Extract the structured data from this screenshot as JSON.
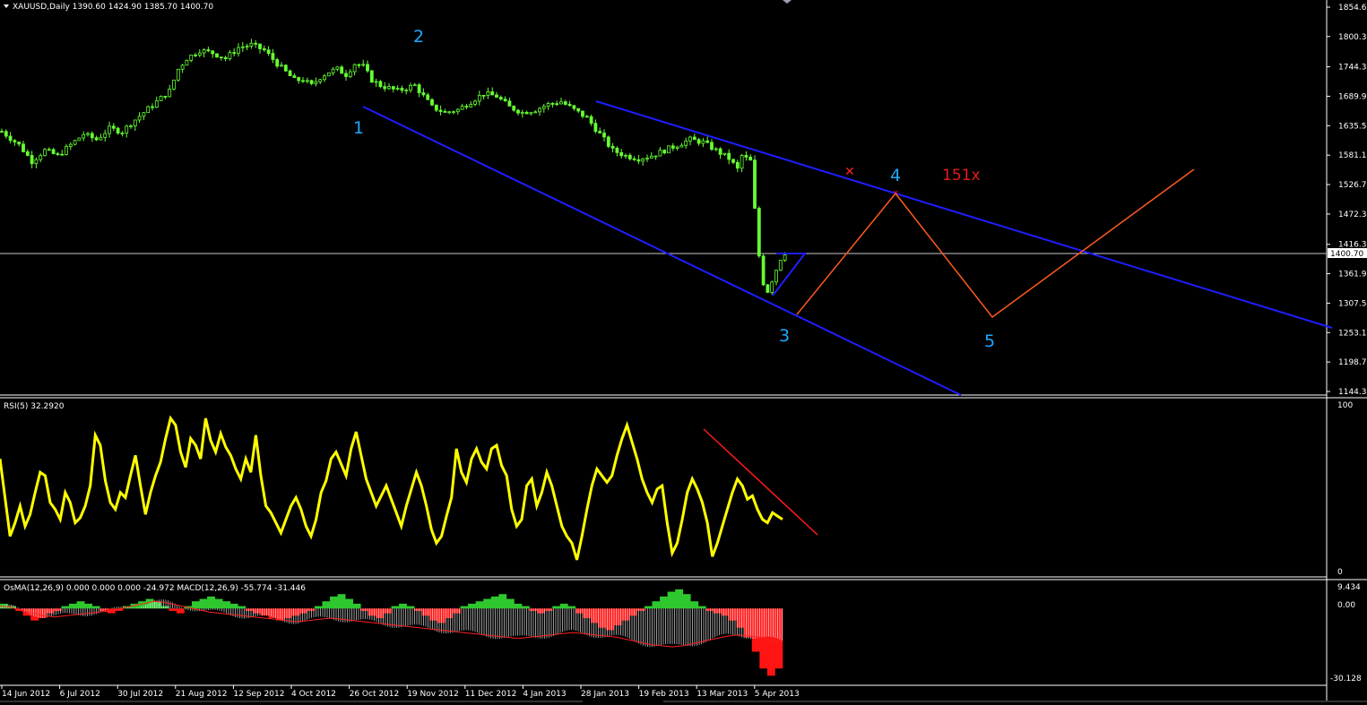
{
  "window": {
    "header": "XAUUSD,Daily  1390.60 1424.90 1385.70 1400.70",
    "colors": {
      "background": "#000000",
      "grid": "#ffffff",
      "candles": "#66ff33",
      "trendline": "#1e1eff",
      "projection": "#ff5a1e",
      "rsi": "#ffff00",
      "rsi_trend": "#ff1a1a",
      "wave_labels": "#1ea8ff",
      "note": "#e81b1b",
      "macd_pos": "#2ec82e",
      "macd_neg": "#ff1414",
      "macd_signal": "#ff2020"
    }
  },
  "chart_data": [
    {
      "type": "candlestick",
      "symbol": "XAUUSD",
      "timeframe": "Daily",
      "last_ohlc": {
        "open": 1390.6,
        "high": 1424.9,
        "low": 1385.7,
        "close": 1400.7
      },
      "y_ticks": [
        "1854.60",
        "1800.34",
        "1744.34",
        "1689.94",
        "1635.54",
        "1581.14",
        "1526.74",
        "1472.34",
        "1416.34",
        "1361.94",
        "1307.54",
        "1253.14",
        "1198.74",
        "1144.34"
      ],
      "ylim": [
        1144.34,
        1854.6
      ],
      "current_price_label": "1400.70",
      "x_tick_labels": [
        "14 Jun 2012",
        "6 Jul 2012",
        "30 Jul 2012",
        "21 Aug 2012",
        "12 Sep 2012",
        "4 Oct 2012",
        "26 Oct 2012",
        "19 Nov 2012",
        "11 Dec 2012",
        "4 Jan 2013",
        "28 Jan 2013",
        "19 Feb 2013",
        "13 Mar 2013",
        "5 Apr 2013"
      ],
      "close_path": [
        [
          0,
          1625
        ],
        [
          4,
          1600
        ],
        [
          7,
          1570
        ],
        [
          10,
          1590
        ],
        [
          13,
          1580
        ],
        [
          16,
          1600
        ],
        [
          19,
          1620
        ],
        [
          22,
          1610
        ],
        [
          25,
          1630
        ],
        [
          28,
          1625
        ],
        [
          30,
          1640
        ],
        [
          33,
          1660
        ],
        [
          36,
          1680
        ],
        [
          39,
          1700
        ],
        [
          41,
          1740
        ],
        [
          43,
          1760
        ],
        [
          46,
          1775
        ],
        [
          49,
          1770
        ],
        [
          52,
          1760
        ],
        [
          55,
          1780
        ],
        [
          58,
          1785
        ],
        [
          61,
          1775
        ],
        [
          64,
          1750
        ],
        [
          66,
          1735
        ],
        [
          68,
          1720
        ],
        [
          70,
          1720
        ],
        [
          72,
          1710
        ],
        [
          74,
          1725
        ],
        [
          76,
          1735
        ],
        [
          78,
          1740
        ],
        [
          80,
          1730
        ],
        [
          82,
          1750
        ],
        [
          84,
          1745
        ],
        [
          86,
          1720
        ],
        [
          88,
          1710
        ],
        [
          90,
          1705
        ],
        [
          92,
          1700
        ],
        [
          94,
          1705
        ],
        [
          96,
          1710
        ],
        [
          98,
          1690
        ],
        [
          100,
          1670
        ],
        [
          103,
          1660
        ],
        [
          106,
          1665
        ],
        [
          109,
          1680
        ],
        [
          112,
          1695
        ],
        [
          115,
          1690
        ],
        [
          118,
          1670
        ],
        [
          121,
          1660
        ],
        [
          124,
          1665
        ],
        [
          127,
          1675
        ],
        [
          130,
          1680
        ],
        [
          133,
          1665
        ],
        [
          136,
          1650
        ],
        [
          139,
          1620
        ],
        [
          142,
          1590
        ],
        [
          145,
          1580
        ],
        [
          148,
          1575
        ],
        [
          151,
          1580
        ],
        [
          154,
          1590
        ],
        [
          157,
          1600
        ],
        [
          160,
          1610
        ],
        [
          163,
          1605
        ],
        [
          166,
          1590
        ],
        [
          169,
          1575
        ],
        [
          171,
          1555
        ],
        [
          172,
          1580
        ],
        [
          174,
          1570
        ],
        [
          175,
          1480
        ],
        [
          176,
          1395
        ],
        [
          177,
          1345
        ],
        [
          178,
          1330
        ],
        [
          179,
          1350
        ],
        [
          180,
          1370
        ],
        [
          181,
          1390
        ],
        [
          182,
          1400.7
        ]
      ],
      "annotations": {
        "wave_labels": [
          "1",
          "2",
          "3",
          "4",
          "5"
        ],
        "note": "151x"
      }
    },
    {
      "type": "line",
      "name": "RSI(5) 32.2920",
      "ylim": [
        0,
        100
      ],
      "y_ticks": [
        "100",
        "0"
      ],
      "values": [
        68,
        45,
        22,
        30,
        40,
        28,
        35,
        48,
        60,
        58,
        42,
        38,
        32,
        48,
        42,
        30,
        33,
        40,
        52,
        82,
        76,
        55,
        42,
        38,
        48,
        45,
        58,
        70,
        52,
        35,
        48,
        58,
        66,
        80,
        92,
        88,
        72,
        63,
        80,
        76,
        68,
        92,
        79,
        72,
        83,
        75,
        70,
        62,
        56,
        68,
        60,
        82,
        58,
        40,
        36,
        30,
        24,
        32,
        40,
        45,
        38,
        28,
        22,
        32,
        48,
        55,
        68,
        72,
        65,
        58,
        74,
        84,
        70,
        56,
        48,
        40,
        46,
        52,
        44,
        36,
        28,
        40,
        50,
        60,
        52,
        40,
        26,
        18,
        22,
        34,
        45,
        74,
        60,
        54,
        68,
        74,
        66,
        62,
        74,
        76,
        64,
        58,
        38,
        28,
        32,
        52,
        56,
        40,
        48,
        60,
        52,
        40,
        28,
        22,
        18,
        8,
        22,
        38,
        52,
        62,
        58,
        54,
        58,
        70,
        80,
        88,
        78,
        68,
        56,
        48,
        42,
        50,
        52,
        30,
        12,
        18,
        32,
        48,
        56,
        50,
        42,
        30,
        10,
        18,
        28,
        38,
        48,
        56,
        52,
        44,
        46,
        38,
        32,
        30,
        36,
        34,
        32
      ]
    },
    {
      "type": "bar",
      "name": "OsMA(12,26,9) 0.000 0.000 0.000 -24.972 MACD(12,26,9) -55.774 -31.446",
      "y_ticks": [
        "9.434",
        "0.00",
        "-30.128"
      ],
      "ylim": [
        -30.128,
        9.434
      ],
      "osma": [
        2,
        1,
        -1,
        -3,
        -5,
        -4,
        -2,
        -1,
        1,
        2,
        3,
        2,
        1,
        -1,
        -2,
        -1,
        1,
        2,
        3,
        4,
        3,
        1,
        -1,
        -2,
        1,
        3,
        4,
        5,
        4,
        3,
        2,
        1,
        -1,
        -2,
        -3,
        -4,
        -5,
        -4,
        -3,
        -2,
        -1,
        1,
        3,
        5,
        6,
        4,
        2,
        -1,
        -3,
        -4,
        -2,
        1,
        2,
        1,
        -1,
        -3,
        -5,
        -6,
        -4,
        -2,
        1,
        2,
        3,
        4,
        5,
        6,
        4,
        2,
        1,
        -1,
        -2,
        -1,
        1,
        2,
        1,
        -2,
        -4,
        -6,
        -8,
        -9,
        -7,
        -5,
        -3,
        -1,
        1,
        3,
        5,
        7,
        8,
        6,
        3,
        1,
        -1,
        -2,
        -3,
        -5,
        -8,
        -12,
        -18,
        -25,
        -28,
        -25
      ],
      "macd_signal": [
        1,
        0.5,
        -1,
        -2,
        -3,
        -3.5,
        -3,
        -2.5,
        -2,
        -1.5,
        -1,
        0,
        1,
        2,
        3,
        2.5,
        1.5,
        0.5,
        -0.5,
        -1.5,
        -2,
        -2.5,
        -3,
        -3.5,
        -4,
        -4.5,
        -5,
        -5.5,
        -5,
        -4.5,
        -4,
        -4.5,
        -5,
        -5.5,
        -6,
        -6.5,
        -7,
        -7.5,
        -8,
        -8.5,
        -9,
        -9.5,
        -10,
        -10.5,
        -11,
        -11.5,
        -12,
        -12.5,
        -12,
        -11.5,
        -11,
        -10.5,
        -10,
        -10.5,
        -11,
        -11.5,
        -12,
        -13,
        -14,
        -15,
        -15.5,
        -16,
        -15.5,
        -14.5,
        -13.5,
        -12.5,
        -11.5,
        -11,
        -11.5,
        -12,
        -13,
        -14
      ]
    }
  ]
}
